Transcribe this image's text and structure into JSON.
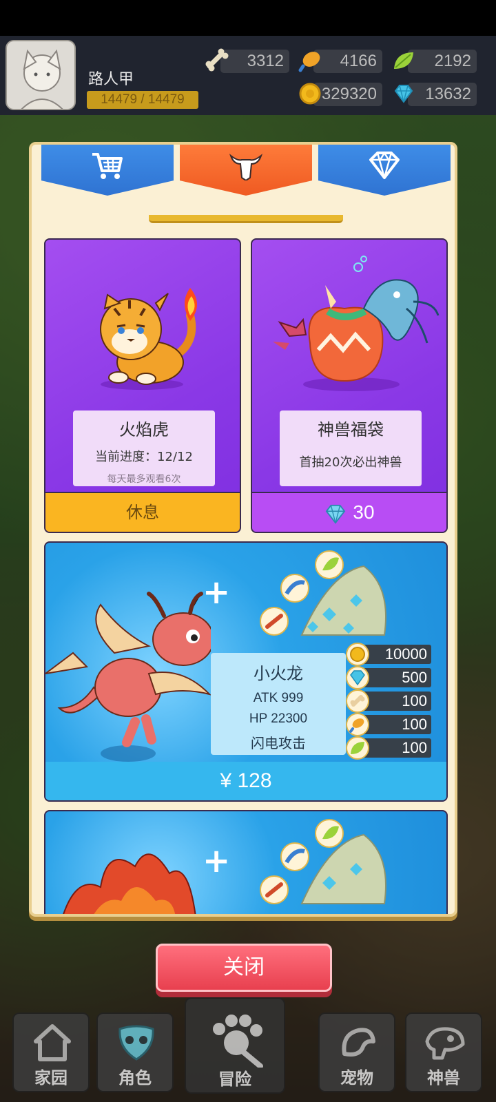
{
  "player": {
    "name": "路人甲",
    "hp_text": "14479 / 14479"
  },
  "resources": {
    "bone": "3312",
    "meat": "4166",
    "leaf": "2192",
    "coin": "329320",
    "gem": "13632"
  },
  "tabs": [
    {
      "name": "shop",
      "icon": "cart-icon"
    },
    {
      "name": "beast",
      "icon": "skull-icon",
      "active": true
    },
    {
      "name": "diamond",
      "icon": "diamond-icon"
    }
  ],
  "cards": {
    "tiger": {
      "title": "火焰虎",
      "progress": "当前进度：12/12",
      "note": "每天最多观看6次",
      "button": "休息"
    },
    "lucky_bag": {
      "title": "神兽福袋",
      "desc": "首抽20次必出神兽",
      "price": "30"
    },
    "dragon": {
      "name": "小火龙",
      "atk": "ATK   999",
      "hp": "HP   22300",
      "skill": "闪电攻击",
      "rewards": [
        "10000",
        "500",
        "100",
        "100",
        "100"
      ],
      "price": "¥ 128"
    }
  },
  "close_label": "关闭",
  "nav": [
    "家园",
    "角色",
    "冒险",
    "宠物",
    "神兽"
  ],
  "colors": {
    "accent_orange": "#ef5a22",
    "tab_blue": "#2f73d2",
    "card_purple": "#8a38e6",
    "rest_button": "#fab521",
    "close_button": "#e8404f"
  }
}
